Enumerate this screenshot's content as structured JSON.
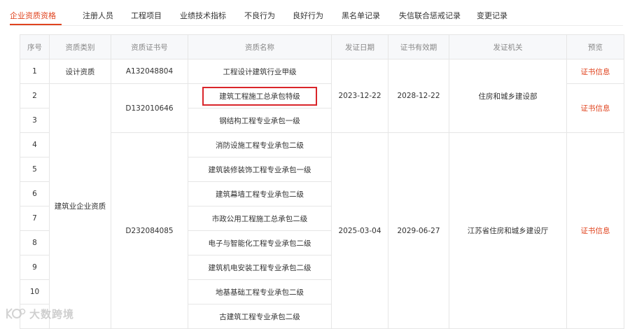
{
  "tabs": [
    {
      "label": "企业资质资格",
      "active": true
    },
    {
      "label": "注册人员"
    },
    {
      "label": "工程项目"
    },
    {
      "label": "业绩技术指标"
    },
    {
      "label": "不良行为"
    },
    {
      "label": "良好行为"
    },
    {
      "label": "黑名单记录"
    },
    {
      "label": "失信联合惩戒记录"
    },
    {
      "label": "变更记录"
    }
  ],
  "table": {
    "headers": [
      "序号",
      "资质类别",
      "资质证书号",
      "资质名称",
      "发证日期",
      "证书有效期",
      "发证机关",
      "预览"
    ],
    "rows": [
      {
        "no": "1",
        "name": "工程设计建筑行业甲级"
      },
      {
        "no": "2",
        "name": "建筑工程施工总承包特级",
        "highlighted": true
      },
      {
        "no": "3",
        "name": "钢结构工程专业承包一级"
      },
      {
        "no": "4",
        "name": "消防设施工程专业承包二级"
      },
      {
        "no": "5",
        "name": "建筑装修装饰工程专业承包一级"
      },
      {
        "no": "6",
        "name": "建筑幕墙工程专业承包二级"
      },
      {
        "no": "7",
        "name": "市政公用工程施工总承包二级"
      },
      {
        "no": "8",
        "name": "电子与智能化工程专业承包二级"
      },
      {
        "no": "9",
        "name": "建筑机电安装工程专业承包二级"
      },
      {
        "no": "10",
        "name": "地基基础工程专业承包二级"
      },
      {
        "no": "",
        "name": "古建筑工程专业承包二级"
      }
    ],
    "groups": {
      "design": {
        "category": "设计资质",
        "cert_no": "A132048804",
        "preview": "证书信息"
      },
      "builder_group": {
        "category": "建筑业企业资质"
      },
      "cert_d1": {
        "cert_no": "D132010646",
        "preview": "证书信息"
      },
      "cert_d2": {
        "cert_no": "D232084085",
        "preview": "证书信息"
      },
      "issue1": {
        "issue_date": "2023-12-22",
        "valid_until": "2028-12-22",
        "authority": "住房和城乡建设部"
      },
      "issue2": {
        "issue_date": "2025-03-04",
        "valid_until": "2029-06-27",
        "authority": "江苏省住房和城乡建设厅"
      }
    }
  },
  "watermark": {
    "text": "大数跨境"
  },
  "colors": {
    "accent": "#e0441f",
    "highlight_border": "#d9252a"
  }
}
